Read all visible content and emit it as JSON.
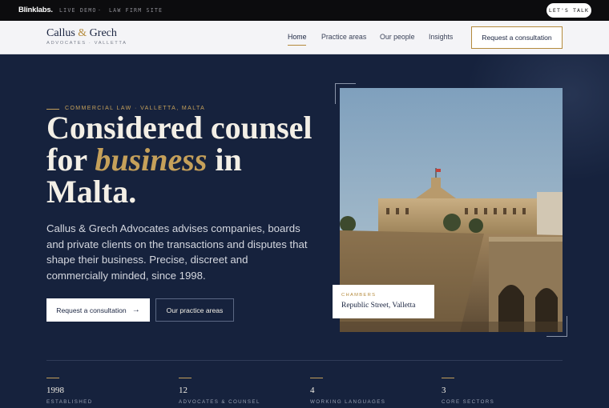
{
  "demo_bar": {
    "logo": "Blinklabs.",
    "live_demo": "LIVE DEMO",
    "separator": "·",
    "site_type": "LAW FIRM SITE",
    "cta": "LET'S TALK"
  },
  "nav": {
    "brand": {
      "name_a": "Callus",
      "amp": "&",
      "name_b": "Grech",
      "subtitle": "ADVOCATES · VALLETTA"
    },
    "links": [
      "Home",
      "Practice areas",
      "Our people",
      "Insights"
    ],
    "active_link": "Home",
    "cta": "Request a consultation"
  },
  "hero": {
    "eyebrow": "COMMERCIAL LAW · VALLETTA, MALTA",
    "headline": {
      "line1": "Considered counsel",
      "line2_pre": "for",
      "line2_accent": "business",
      "line2_post": "in",
      "line3": "Malta."
    },
    "lede": "Callus & Grech Advocates advises companies, boards and private clients on the transactions and disputes that shape their business. Precise, discreet and commercially minded, since 1998.",
    "primary_cta": "Request a consultation",
    "primary_cta_icon": "arrow-right-icon",
    "secondary_cta": "Our practice areas",
    "photo_caption": {
      "label": "CHAMBERS",
      "value": "Republic Street, Valletta"
    }
  },
  "stats": [
    {
      "value": "1998",
      "label": "ESTABLISHED"
    },
    {
      "value": "12",
      "label": "ADVOCATES & COUNSEL"
    },
    {
      "value": "4",
      "label": "WORKING LANGUAGES"
    },
    {
      "value": "3",
      "label": "CORE SECTORS"
    }
  ],
  "colors": {
    "navy": "#16223d",
    "gold": "#c5a05a",
    "nav_bg": "#f4f4f7",
    "demo_bar": "#0c0c0e"
  }
}
